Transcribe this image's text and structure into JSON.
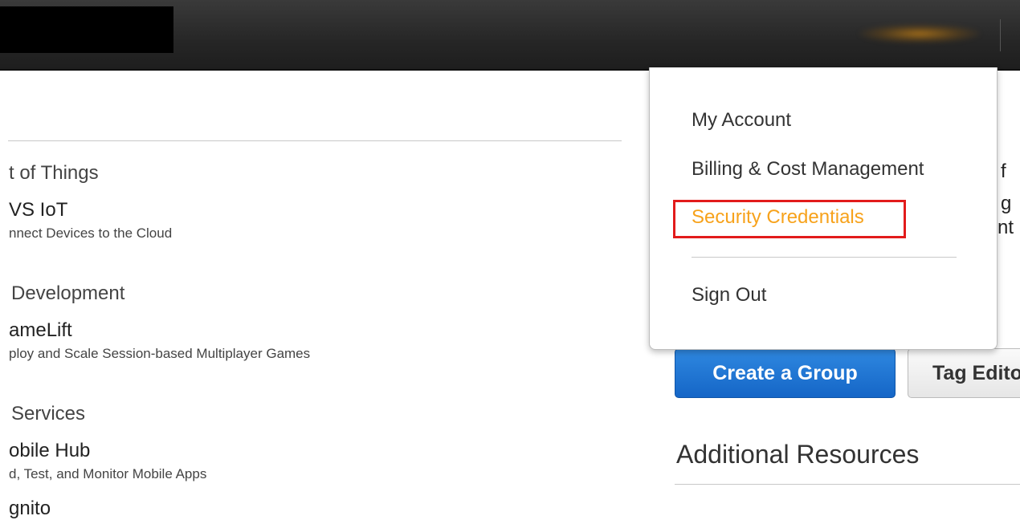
{
  "topbar": {
    "logo_label": "",
    "user_menu_label": ""
  },
  "services": {
    "groups": [
      {
        "heading": "t of Things",
        "items": [
          {
            "name": "VS IoT",
            "desc": "nnect Devices to the Cloud"
          }
        ]
      },
      {
        "heading": "Development",
        "items": [
          {
            "name": "ameLift",
            "desc": "ploy and Scale Session-based Multiplayer Games"
          }
        ]
      },
      {
        "heading": "Services",
        "items": [
          {
            "name": "obile Hub",
            "desc": "d, Test, and Monitor Mobile Apps"
          },
          {
            "name": "gnito",
            "desc": ""
          }
        ]
      }
    ]
  },
  "dropdown": {
    "items": [
      {
        "label": "My Account"
      },
      {
        "label": "Billing & Cost Management"
      },
      {
        "label": "Security Credentials"
      },
      {
        "label": "Sign Out"
      }
    ],
    "highlight_color": "#e21b1b",
    "active_color": "#f7a21b"
  },
  "right": {
    "peek_lines": [
      "f",
      "g",
      "nt"
    ],
    "create_group_label": "Create a Group",
    "tag_editor_label": "Tag Editor",
    "additional_resources": "Additional Resources"
  }
}
